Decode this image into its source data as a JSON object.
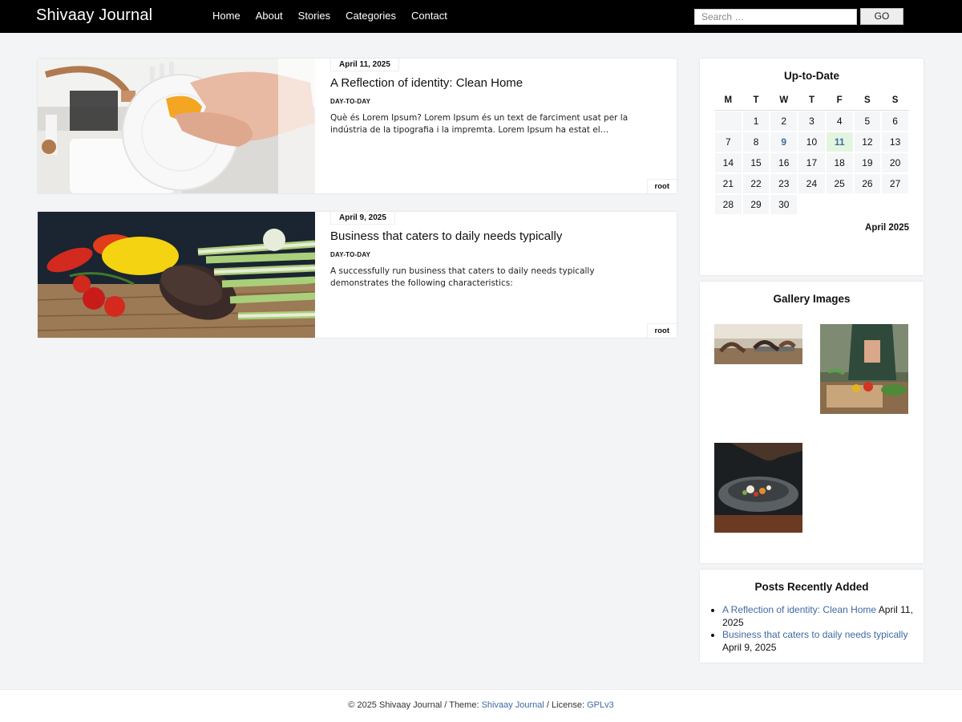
{
  "header": {
    "brand": "Shivaay Journal",
    "nav": [
      "Home",
      "About",
      "Stories",
      "Categories",
      "Contact"
    ],
    "search_placeholder": "Search …",
    "go_label": "GO"
  },
  "posts": [
    {
      "date": "April 11, 2025",
      "title": "A Reflection of identity: Clean Home",
      "category": "DAY-TO-DAY",
      "excerpt": "Què és Lorem Ipsum? Lorem Ipsum és un text de farciment usat per la indústria de la tipografia i la impremta. Lorem Ipsum ha estat el…",
      "author": "root",
      "image": "washing-dish-image"
    },
    {
      "date": "April 9, 2025",
      "title": "Business that caters to daily needs typically",
      "category": "DAY-TO-DAY",
      "excerpt": "A successfully run business that caters to daily needs typically demonstrates the following characteristics:",
      "author": "root",
      "image": "vegetables-image"
    }
  ],
  "calendar": {
    "title": "Up-to-Date",
    "weekdays": [
      "M",
      "T",
      "W",
      "T",
      "F",
      "S",
      "S"
    ],
    "weeks": [
      [
        "",
        "1",
        "2",
        "3",
        "4",
        "5",
        "6"
      ],
      [
        "7",
        "8",
        "9",
        "10",
        "11",
        "12",
        "13"
      ],
      [
        "14",
        "15",
        "16",
        "17",
        "18",
        "19",
        "20"
      ],
      [
        "21",
        "22",
        "23",
        "24",
        "25",
        "26",
        "27"
      ],
      [
        "28",
        "29",
        "30",
        "",
        "",
        "",
        ""
      ]
    ],
    "linked_days": [
      "9"
    ],
    "today": "11",
    "caption": "April 2025"
  },
  "gallery": {
    "title": "Gallery Images",
    "images": [
      "yoga-class-image",
      "chopping-vegetables-image",
      "plated-dish-image"
    ]
  },
  "recent_posts": {
    "title": "Posts Recently Added",
    "items": [
      {
        "title": "A Reflection of identity: Clean Home",
        "date": "April 11, 2025"
      },
      {
        "title": "Business that caters to daily needs typically",
        "date": "April 9, 2025"
      }
    ]
  },
  "footer": {
    "prefix": "© 2025 Shivaay Journal / Theme: ",
    "theme_link": "Shivaay Journal",
    "middle": " / License: ",
    "license_link": "GPLv3"
  },
  "colors": {
    "link": "#3f6aa3",
    "header_bg": "#000000",
    "page_bg": "#f3f4f6",
    "today_bg": "#e3f5df"
  }
}
